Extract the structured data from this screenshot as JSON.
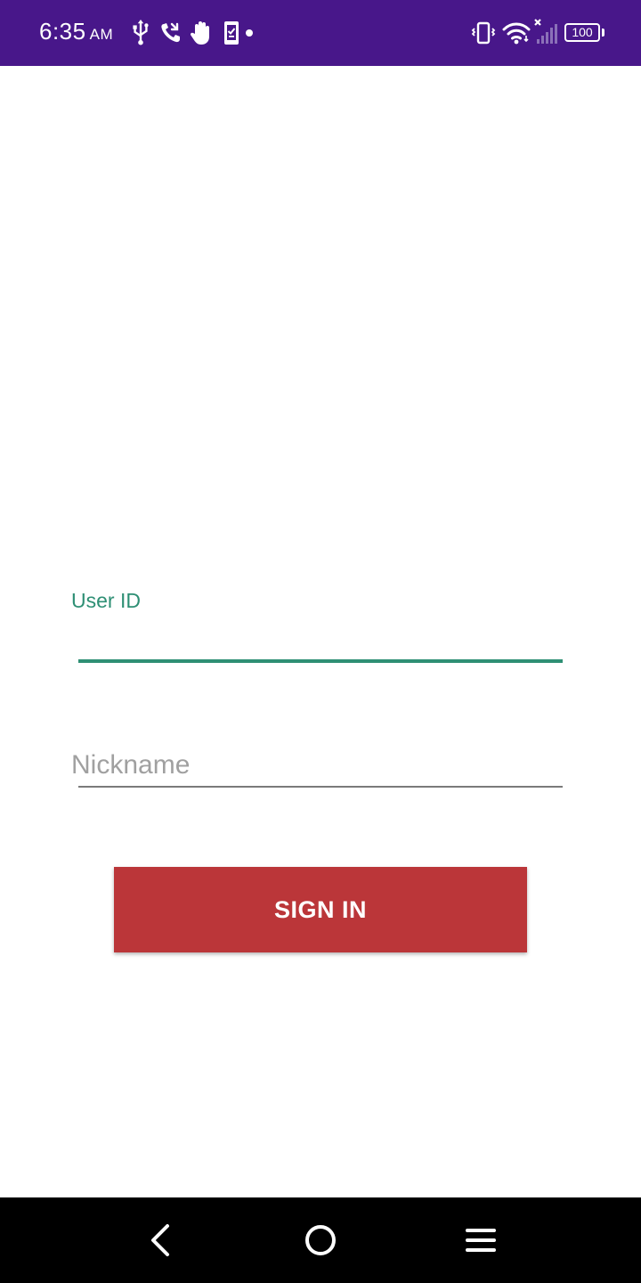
{
  "status_bar": {
    "time": "6:35",
    "ampm": "AM",
    "battery_level": "100",
    "left_icons": [
      "usb-icon",
      "wifi-calling-icon",
      "hand-icon",
      "phone-check-icon",
      "notification-dot-icon"
    ],
    "right_icons": [
      "vibrate-icon",
      "wifi-icon",
      "signal-off-icon",
      "battery-icon"
    ],
    "background_color": "#48178a"
  },
  "form": {
    "userid_label": "User ID",
    "userid_value": "",
    "nickname_placeholder": "Nickname",
    "nickname_value": "",
    "signin_label": "SIGN IN",
    "accent_color": "#2e8f74",
    "button_color": "#bb3639"
  },
  "nav_bar": {
    "buttons": [
      "back-icon",
      "home-icon",
      "menu-icon"
    ]
  }
}
